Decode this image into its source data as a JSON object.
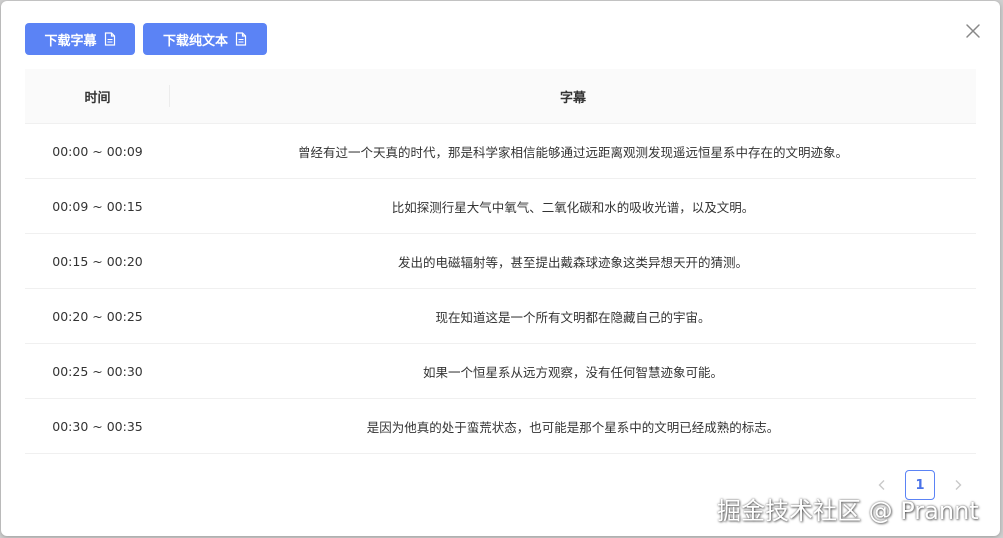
{
  "toolbar": {
    "download_subtitle_label": "下载字幕",
    "download_text_label": "下载纯文本"
  },
  "table": {
    "headers": {
      "time": "时间",
      "subtitle": "字幕"
    },
    "rows": [
      {
        "time": "00:00 ~ 00:09",
        "text": "曾经有过一个天真的时代，那是科学家相信能够通过远距离观测发现遥远恒星系中存在的文明迹象。"
      },
      {
        "time": "00:09 ~ 00:15",
        "text": "比如探测行星大气中氧气、二氧化碳和水的吸收光谱，以及文明。"
      },
      {
        "time": "00:15 ~ 00:20",
        "text": "发出的电磁辐射等，甚至提出戴森球迹象这类异想天开的猜测。"
      },
      {
        "time": "00:20 ~ 00:25",
        "text": "现在知道这是一个所有文明都在隐藏自己的宇宙。"
      },
      {
        "time": "00:25 ~ 00:30",
        "text": "如果一个恒星系从远方观察，没有任何智慧迹象可能。"
      },
      {
        "time": "00:30 ~ 00:35",
        "text": "是因为他真的处于蛮荒状态，也可能是那个星系中的文明已经成熟的标志。"
      }
    ]
  },
  "pagination": {
    "current_page": "1"
  },
  "watermark": "掘金技术社区 @ Prannt",
  "colors": {
    "accent": "#5b83f5",
    "header_bg": "#fafafa"
  }
}
